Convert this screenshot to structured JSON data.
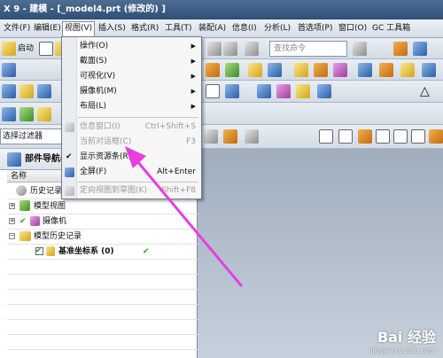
{
  "window": {
    "title": "X 9 - 建模 - [_model4.prt  (修改的) ]"
  },
  "menubar": {
    "items": [
      "文件(F)",
      "编辑(E)",
      "视图(V)",
      "插入(S)",
      "格式(R)",
      "工具(T)",
      "装配(A)",
      "信息(I)",
      "分析(L)",
      "首选项(P)",
      "窗口(O)",
      "GC 工具箱"
    ]
  },
  "toolbar": {
    "start_label": "启动",
    "search_placeholder": "查找命令",
    "filter_value": "选择过滤器"
  },
  "view_menu": {
    "items": [
      {
        "label": "操作(O)",
        "submenu": true,
        "enabled": true
      },
      {
        "label": "截面(S)",
        "submenu": true,
        "enabled": true
      },
      {
        "label": "可视化(V)",
        "submenu": true,
        "enabled": true
      },
      {
        "label": "摄像机(M)",
        "submenu": true,
        "enabled": true
      },
      {
        "label": "布局(L)",
        "submenu": true,
        "enabled": true
      },
      {
        "label": "信息窗口(I)",
        "shortcut": "Ctrl+Shift+S",
        "enabled": false
      },
      {
        "label": "当前对话框(C)",
        "shortcut": "F3",
        "enabled": false
      },
      {
        "label": "显示资源条(R)",
        "checked": true,
        "enabled": true
      },
      {
        "label": "全屏(F)",
        "shortcut": "Alt+Enter",
        "enabled": true
      },
      {
        "label": "定向视图到草图(K)",
        "shortcut": "Shift+F8",
        "enabled": false
      }
    ]
  },
  "navigator": {
    "title": "部件导航器",
    "column_name": "名称",
    "rows": [
      {
        "label": "历史记录"
      },
      {
        "label": "模型视图"
      },
      {
        "label": "摄像机"
      },
      {
        "label": "模型历史记录"
      },
      {
        "label": "基准坐标系 (0)",
        "status": "✔"
      }
    ]
  },
  "watermark": {
    "text": "Bai 经验",
    "sub": "jingyan.baidu.com"
  },
  "colors": {
    "annotation_arrow": "#e83ee0",
    "titlebar": "#2f4f77"
  }
}
